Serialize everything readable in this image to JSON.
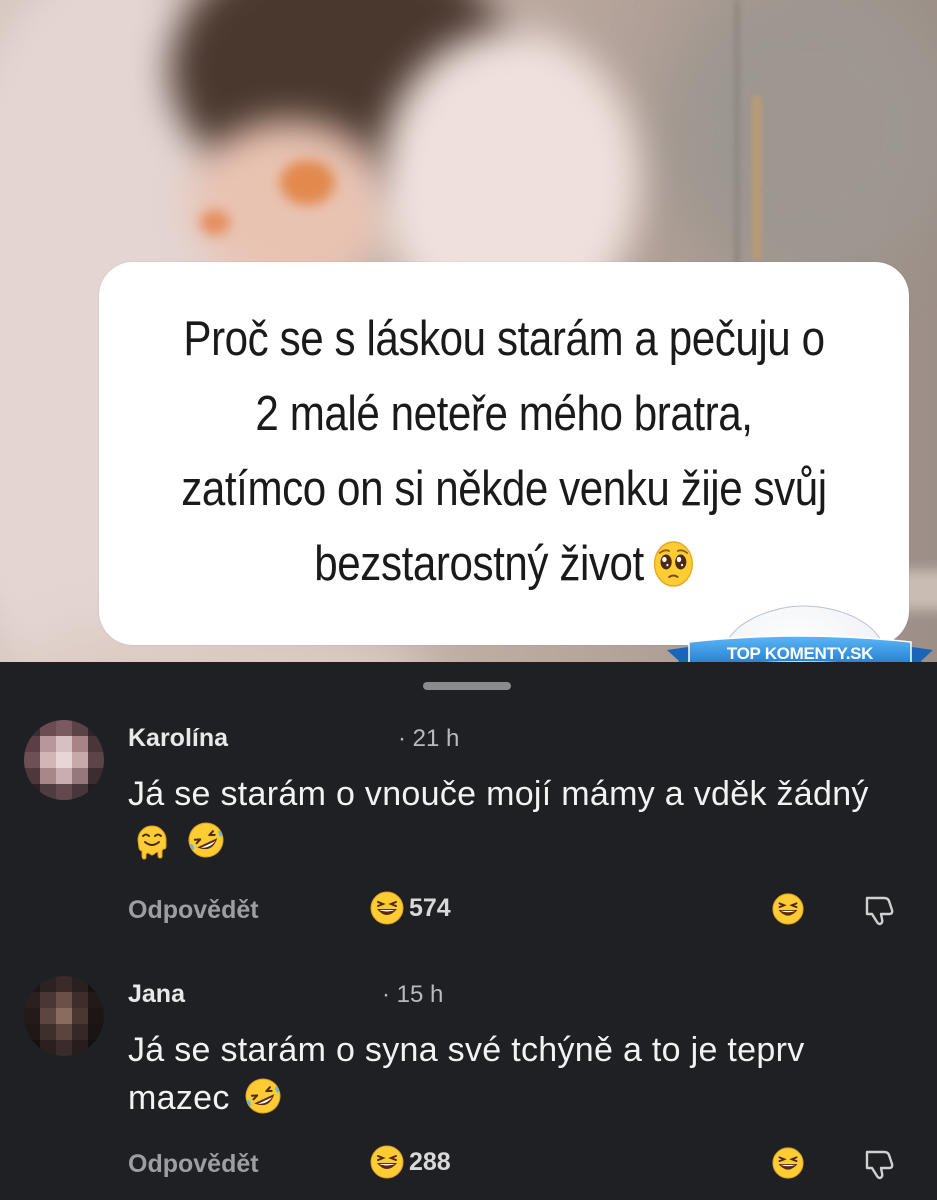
{
  "caption": {
    "lines": [
      "Proč se s láskou starám a pečuju o",
      "2 malé neteře mého bratra,",
      "zatímco on si někde venku žije svůj",
      "bezstarostný život"
    ],
    "emoji": "pleading-face"
  },
  "watermark": {
    "text": "TOP KOMENTY.SK"
  },
  "comments": [
    {
      "author": "Karolína",
      "time": "· 21 h",
      "text": "Já se starám o vnouče mojí mámy a vděk žádný",
      "emojis": [
        "melting-face",
        "rolling-laughing-face"
      ],
      "reply_label": "Odpovědět",
      "like_count": "574",
      "avatar_colors": [
        [
          "#3b2f33",
          "#6a4c52",
          "#7a5a60",
          "#5b4247",
          "#2e2528"
        ],
        [
          "#5a4046",
          "#b7979b",
          "#d7c0c2",
          "#a88387",
          "#4a3539"
        ],
        [
          "#6c5055",
          "#d1b6b8",
          "#e8d5d6",
          "#c7a9ac",
          "#5c4448"
        ],
        [
          "#4d383c",
          "#a8878b",
          "#c9adb0",
          "#96777b",
          "#3d2d30"
        ],
        [
          "#2a2124",
          "#4e3c40",
          "#62494e",
          "#47363a",
          "#231b1d"
        ]
      ]
    },
    {
      "author": "Jana",
      "time": "· 15 h",
      "text": "Já se starám o syna své tchýně a to je teprv mazec",
      "emojis": [
        "rolling-laughing-face"
      ],
      "reply_label": "Odpovědět",
      "like_count": "288",
      "avatar_colors": [
        [
          "#1d1717",
          "#2c2222",
          "#3a2b29",
          "#2a2020",
          "#181313"
        ],
        [
          "#2b201f",
          "#4a3634",
          "#6b5048",
          "#3e2d2b",
          "#221a19"
        ],
        [
          "#231b1a",
          "#5c463f",
          "#8a6b5f",
          "#4b3732",
          "#1d1615"
        ],
        [
          "#1f1817",
          "#3e2f2c",
          "#5a443d",
          "#352826",
          "#1a1414"
        ],
        [
          "#151111",
          "#2a201f",
          "#3a2c2a",
          "#261d1c",
          "#121010"
        ]
      ]
    }
  ],
  "colors": {
    "panel_bg": "#1f2023",
    "caption_bg": "#ffffff",
    "watermark_blue": "#2f8fe0"
  }
}
